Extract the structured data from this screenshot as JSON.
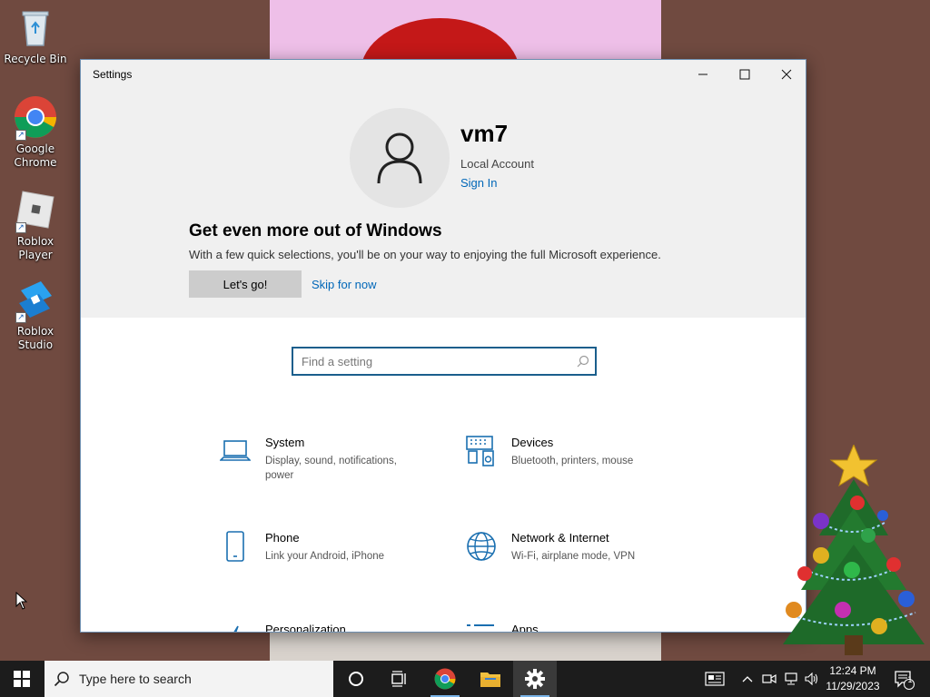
{
  "desktop": {
    "icons": [
      {
        "label": "Recycle Bin"
      },
      {
        "label": "Google Chrome"
      },
      {
        "label": "Roblox Player"
      },
      {
        "label": "Roblox Studio"
      }
    ]
  },
  "window": {
    "title": "Settings",
    "controls": {
      "minimize": "—",
      "maximize": "☐",
      "close": "✕"
    }
  },
  "account": {
    "username": "vm7",
    "type": "Local Account",
    "signin_label": "Sign In"
  },
  "promo": {
    "title": "Get even more out of Windows",
    "description": "With a few quick selections, you'll be on your way to enjoying the full Microsoft experience.",
    "primary_label": "Let's go!",
    "secondary_label": "Skip for now"
  },
  "search": {
    "placeholder": "Find a setting",
    "value": ""
  },
  "categories": [
    {
      "title": "System",
      "description": "Display, sound, notifications, power",
      "icon": "laptop-icon"
    },
    {
      "title": "Devices",
      "description": "Bluetooth, printers, mouse",
      "icon": "devices-icon"
    },
    {
      "title": "Phone",
      "description": "Link your Android, iPhone",
      "icon": "phone-icon"
    },
    {
      "title": "Network & Internet",
      "description": "Wi-Fi, airplane mode, VPN",
      "icon": "globe-icon"
    },
    {
      "title": "Personalization",
      "description": "",
      "icon": "brush-icon"
    },
    {
      "title": "Apps",
      "description": "",
      "icon": "apps-icon"
    }
  ],
  "taskbar": {
    "search_text": "Type here to search",
    "time": "12:24 PM",
    "date": "11/29/2023",
    "notification_count": "1"
  },
  "colors": {
    "accent": "#0067b8",
    "search_border": "#1a5e8c",
    "icon_blue": "#1a6fb0"
  }
}
